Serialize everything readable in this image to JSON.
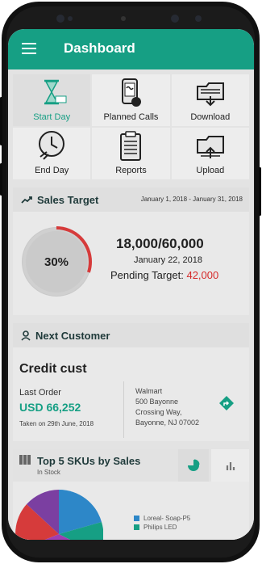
{
  "app": {
    "title": "Dashboard"
  },
  "grid": {
    "tiles": [
      {
        "label": "Start Day",
        "icon": "hourglass-icon",
        "active": true
      },
      {
        "label": "Planned Calls",
        "icon": "phone-call-icon",
        "active": false
      },
      {
        "label": "Download",
        "icon": "download-folder-icon",
        "active": false
      },
      {
        "label": "End Day",
        "icon": "clock-icon",
        "active": false
      },
      {
        "label": "Reports",
        "icon": "clipboard-icon",
        "active": false
      },
      {
        "label": "Upload",
        "icon": "upload-folder-icon",
        "active": false
      }
    ]
  },
  "sales_target": {
    "title": "Sales Target",
    "date_range": "January 1, 2018 - January 31, 2018",
    "percent_label": "30%",
    "progress_fraction": 0.3,
    "achieved": "18,000/60,000",
    "date": "January 22, 2018",
    "pending_label": "Pending Target:",
    "pending_value": "42,000"
  },
  "next_customer": {
    "title": "Next Customer",
    "name": "Credit cust",
    "last_order_label": "Last Order",
    "amount": "USD 66,252",
    "taken": "Taken on 29th June, 2018",
    "address_lines": [
      "Walmart",
      "500 Bayonne",
      "Crossing Way,",
      "Bayonne, NJ 07002"
    ]
  },
  "skus": {
    "title": "Top 5 SKUs by Sales",
    "subtitle": "In Stock",
    "legend": [
      {
        "label": "Loreal- Soap-P5",
        "color": "#2d87c8"
      },
      {
        "label": "Philips LED",
        "color": "#169f84"
      }
    ]
  },
  "colors": {
    "accent": "#169f84",
    "danger": "#d62a2a"
  }
}
